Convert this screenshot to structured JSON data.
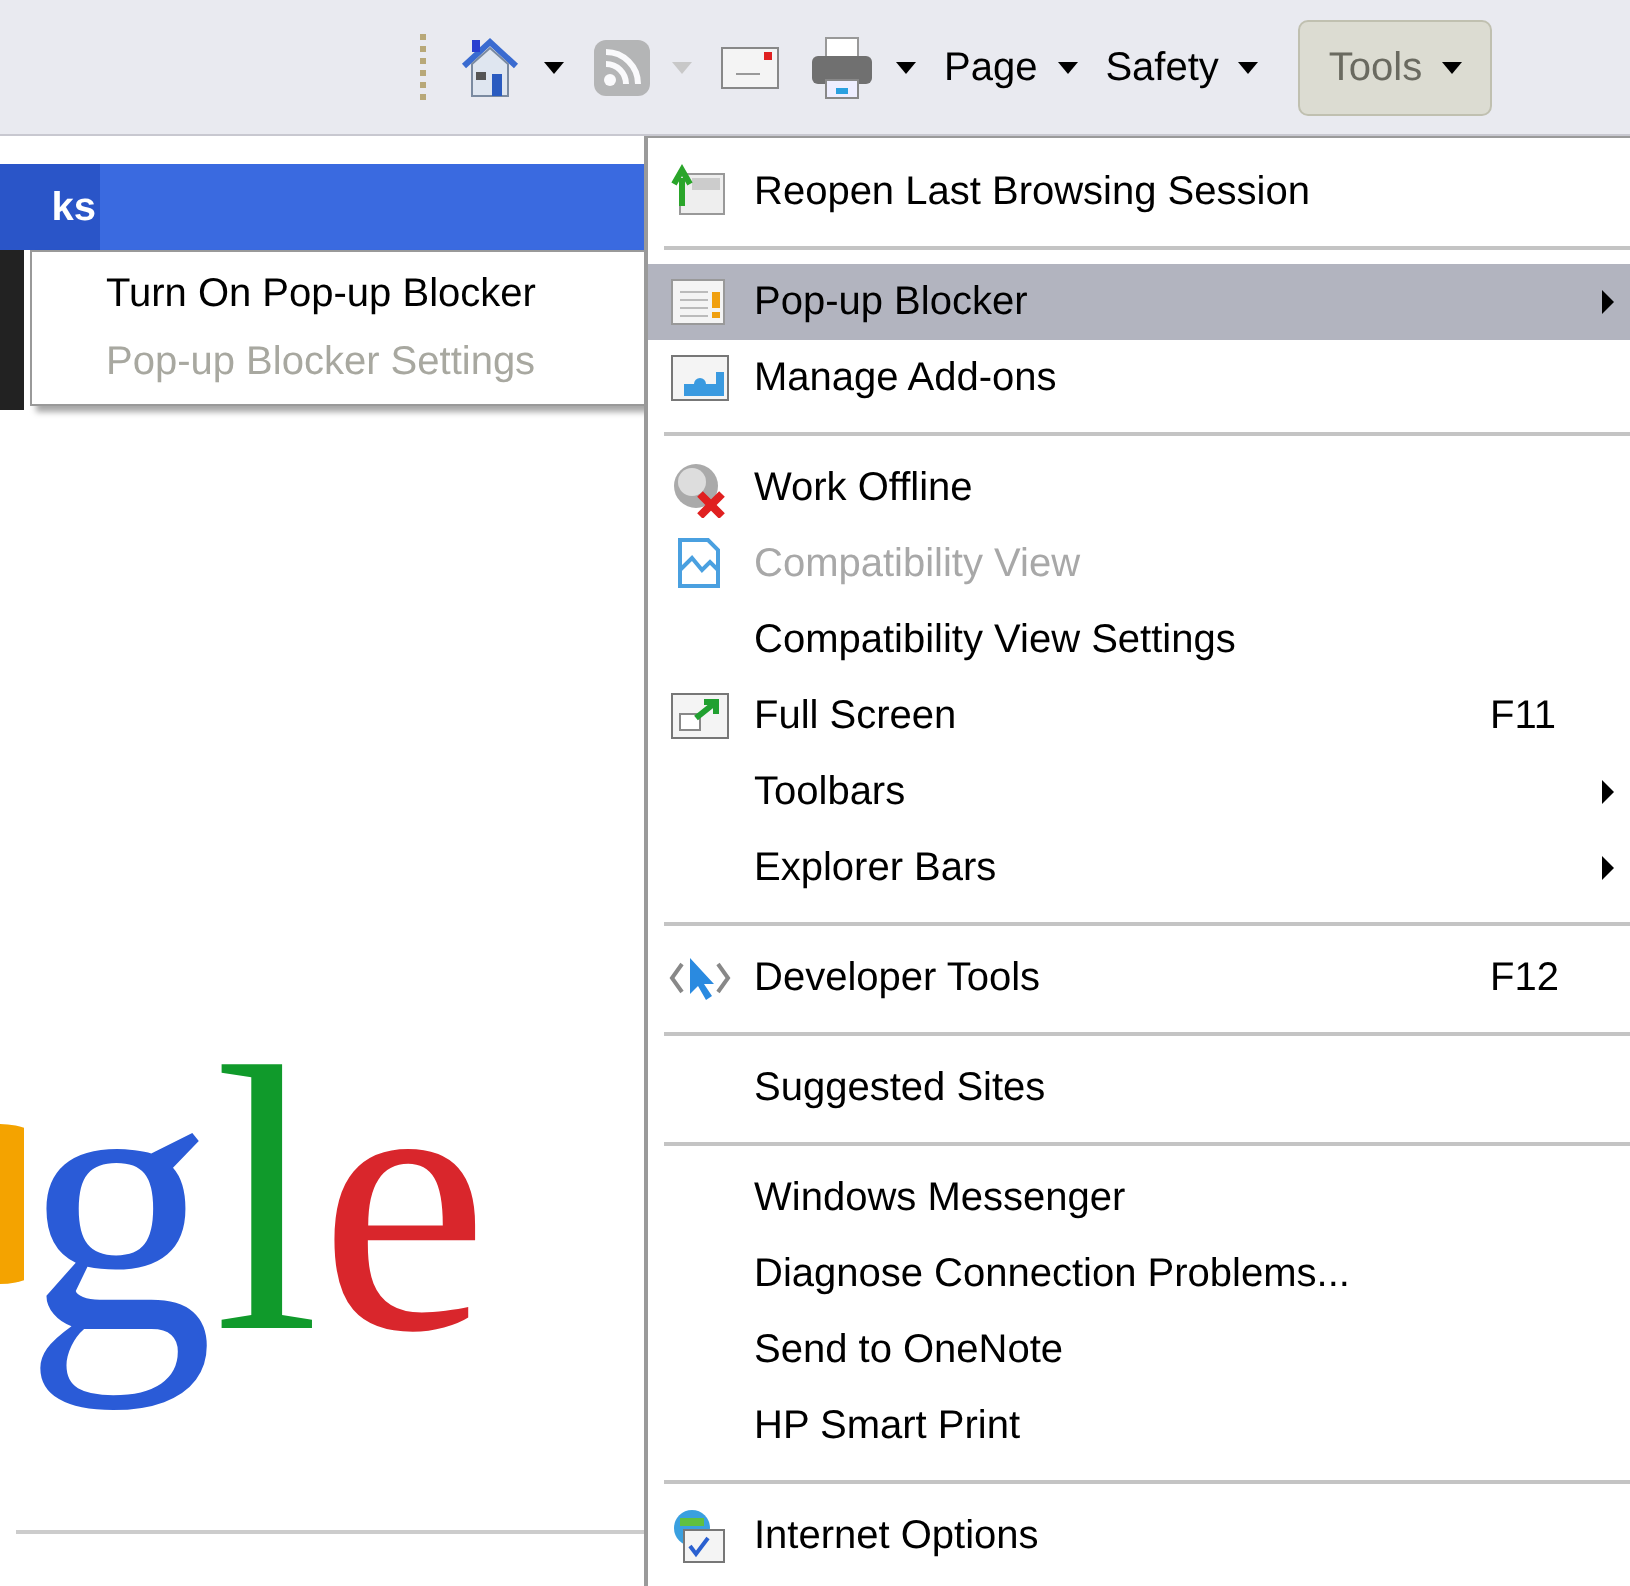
{
  "toolbar": {
    "items": [
      {
        "kind": "home",
        "dropdown": true,
        "disabled": false,
        "open": false
      },
      {
        "kind": "feeds",
        "dropdown": true,
        "disabled": true,
        "open": false
      },
      {
        "kind": "mail",
        "dropdown": false,
        "disabled": false,
        "open": false
      },
      {
        "kind": "print",
        "dropdown": true,
        "disabled": false,
        "open": false
      },
      {
        "kind": "menu",
        "label": "Page",
        "dropdown": true,
        "disabled": false,
        "open": false
      },
      {
        "kind": "menu",
        "label": "Safety",
        "dropdown": true,
        "disabled": false,
        "open": false
      },
      {
        "kind": "menu",
        "label": "Tools",
        "dropdown": true,
        "disabled": false,
        "open": true
      }
    ]
  },
  "page": {
    "bar_text": "ks",
    "logo_letters": [
      {
        "text": "g",
        "color": "#2a5bd7"
      },
      {
        "text": "l",
        "color": "#109a2b"
      },
      {
        "text": "e",
        "color": "#d9262c"
      }
    ]
  },
  "submenu": {
    "items": [
      {
        "label": "Turn On Pop-up Blocker",
        "disabled": false
      },
      {
        "label": "Pop-up Blocker Settings",
        "disabled": true
      }
    ]
  },
  "menu": {
    "items": [
      {
        "kind": "reopen",
        "label": "Reopen Last Browsing Session",
        "selected": false,
        "disabled": false,
        "has_submenu": false
      },
      {
        "kind": "separator"
      },
      {
        "kind": "popup",
        "label": "Pop-up Blocker",
        "selected": true,
        "disabled": false,
        "has_submenu": true
      },
      {
        "kind": "addons",
        "label": "Manage Add-ons",
        "selected": false,
        "disabled": false,
        "has_submenu": false
      },
      {
        "kind": "separator"
      },
      {
        "kind": "offline",
        "label": "Work Offline",
        "selected": false,
        "disabled": false,
        "has_submenu": false
      },
      {
        "kind": "compat",
        "label": "Compatibility View",
        "selected": false,
        "disabled": true,
        "has_submenu": false
      },
      {
        "kind": "plain",
        "label": "Compatibility View Settings",
        "selected": false,
        "disabled": false,
        "has_submenu": false
      },
      {
        "kind": "fullscreen",
        "label": "Full Screen",
        "shortcut": "F11",
        "selected": false,
        "disabled": false,
        "has_submenu": false
      },
      {
        "kind": "plain",
        "label": "Toolbars",
        "selected": false,
        "disabled": false,
        "has_submenu": true
      },
      {
        "kind": "plain",
        "label": "Explorer Bars",
        "selected": false,
        "disabled": false,
        "has_submenu": true
      },
      {
        "kind": "separator"
      },
      {
        "kind": "devtools",
        "label": "Developer Tools",
        "shortcut": "F12",
        "selected": false,
        "disabled": false,
        "has_submenu": false
      },
      {
        "kind": "separator"
      },
      {
        "kind": "plain",
        "label": "Suggested Sites",
        "selected": false,
        "disabled": false,
        "has_submenu": false
      },
      {
        "kind": "separator"
      },
      {
        "kind": "plain",
        "label": "Windows Messenger",
        "selected": false,
        "disabled": false,
        "has_submenu": false
      },
      {
        "kind": "plain",
        "label": "Diagnose Connection Problems...",
        "selected": false,
        "disabled": false,
        "has_submenu": false
      },
      {
        "kind": "plain",
        "label": "Send to OneNote",
        "selected": false,
        "disabled": false,
        "has_submenu": false
      },
      {
        "kind": "plain",
        "label": "HP Smart Print",
        "selected": false,
        "disabled": false,
        "has_submenu": false
      },
      {
        "kind": "separator"
      },
      {
        "kind": "options",
        "label": "Internet Options",
        "selected": false,
        "disabled": false,
        "has_submenu": false
      }
    ]
  }
}
